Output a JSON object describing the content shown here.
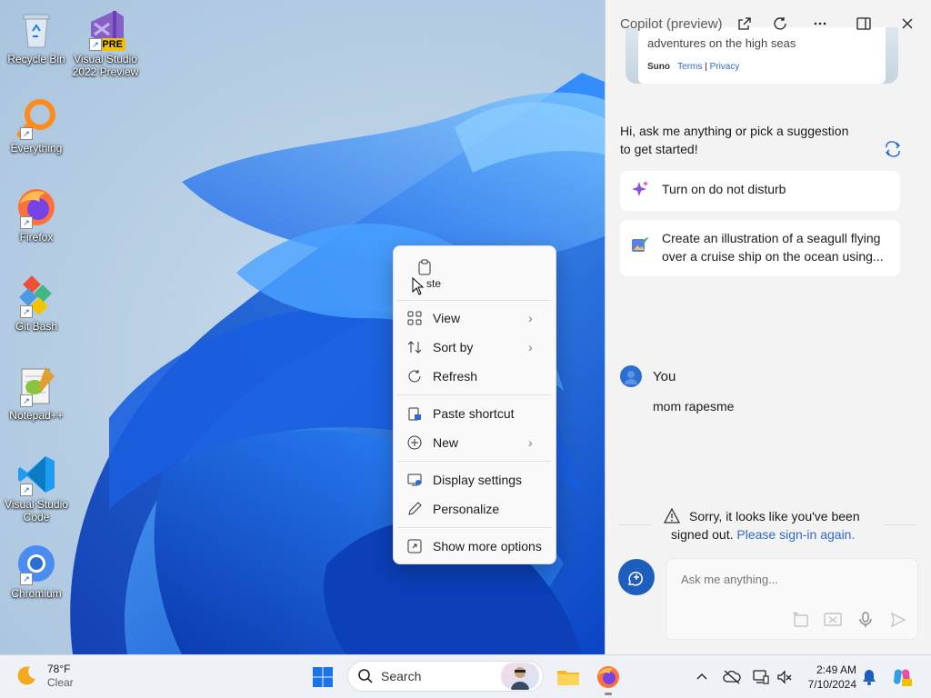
{
  "desktop": {
    "icons": [
      {
        "label_line1": "Recycle Bin",
        "label_line2": "",
        "icon": "recycle-bin-icon"
      },
      {
        "label_line1": "Visual Studio",
        "label_line2": "2022 Preview",
        "icon": "visual-studio-preview-icon",
        "badge": "PRE"
      },
      {
        "label_line1": "Everything",
        "label_line2": "",
        "icon": "everything-search-icon"
      },
      {
        "label_line1": "Firefox",
        "label_line2": "",
        "icon": "firefox-icon"
      },
      {
        "label_line1": "Git Bash",
        "label_line2": "",
        "icon": "git-bash-icon"
      },
      {
        "label_line1": "Notepad++",
        "label_line2": "",
        "icon": "notepad-plus-plus-icon"
      },
      {
        "label_line1": "Visual Studio",
        "label_line2": "Code",
        "icon": "vscode-icon"
      },
      {
        "label_line1": "Chromium",
        "label_line2": "",
        "icon": "chromium-icon"
      }
    ]
  },
  "context_menu": {
    "paste_label": "ste",
    "items": [
      {
        "label": "View",
        "icon": "grid-view-icon",
        "submenu": true
      },
      {
        "label": "Sort by",
        "icon": "sort-icon",
        "submenu": true
      },
      {
        "label": "Refresh",
        "icon": "refresh-icon",
        "submenu": false
      },
      {
        "label": "Paste shortcut",
        "icon": "paste-shortcut-icon",
        "submenu": false
      },
      {
        "label": "New",
        "icon": "new-plus-icon",
        "submenu": true
      },
      {
        "label": "Display settings",
        "icon": "display-settings-icon",
        "submenu": false
      },
      {
        "label": "Personalize",
        "icon": "pen-icon",
        "submenu": false
      },
      {
        "label": "Show more options",
        "icon": "show-more-options-icon",
        "submenu": false
      }
    ],
    "chevron": "›"
  },
  "copilot": {
    "title": "Copilot (preview)",
    "suno": {
      "song_text": "adventures on the high seas",
      "brand": "Suno",
      "terms": "Terms",
      "separator": "|",
      "privacy": "Privacy"
    },
    "greeting_line1": "Hi, ask me anything or pick a suggestion",
    "greeting_line2": "to get started!",
    "suggestions": [
      {
        "line1": "Turn on do not disturb",
        "line2": "",
        "icon": "sparkle-icon"
      },
      {
        "line1": "Create an illustration of a seagull flying",
        "line2": "over a cruise ship on the ocean using...",
        "icon": "image-create-icon"
      }
    ],
    "user_label": "You",
    "user_message": "mom rapesme",
    "signin_line1": "Sorry, it looks like you've been",
    "signin_line2_prefix": "signed out.",
    "signin_link": "Please sign-in again.",
    "input_placeholder": "Ask me anything...",
    "accent": "#2f6ad0"
  },
  "taskbar": {
    "weather_temp": "78°F",
    "weather_condition": "Clear",
    "search_label": "Search",
    "time": "2:49 AM",
    "date": "7/10/2024"
  }
}
